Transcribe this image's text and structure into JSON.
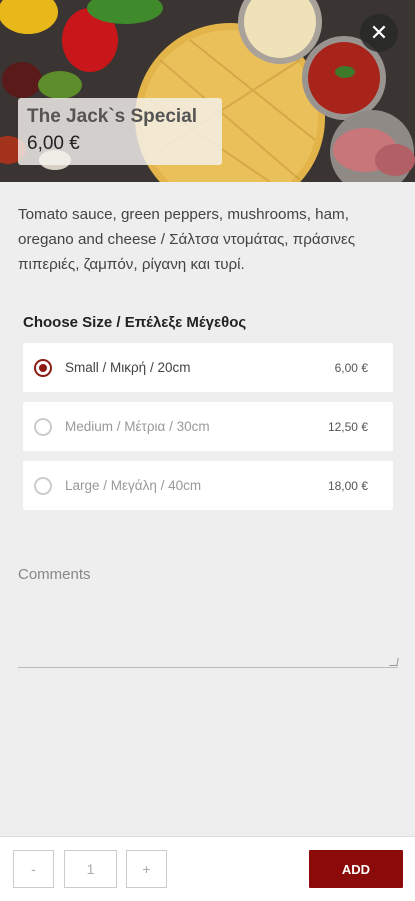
{
  "product": {
    "name": "The Jack`s Special",
    "price": "6,00 €",
    "description": "Tomato sauce, green peppers, mushrooms, ham, oregano and cheese / Σάλτσα ντομάτας, πράσινες πιπεριές, ζαμπόν, ρίγανη και τυρί."
  },
  "size_section": {
    "heading": "Choose Size / Επέλεξε Μέγεθος",
    "options": [
      {
        "label": "Small / Μικρή / 20cm",
        "price": "6,00 €",
        "selected": true
      },
      {
        "label": "Medium / Μέτρια / 30cm",
        "price": "12,50 €",
        "selected": false
      },
      {
        "label": "Large / Μεγάλη / 40cm",
        "price": "18,00 €",
        "selected": false
      }
    ]
  },
  "comments": {
    "placeholder": "Comments"
  },
  "footer": {
    "minus_label": "-",
    "quantity": "1",
    "plus_label": "+",
    "add_label": "ADD"
  },
  "icons": {
    "close": "close-icon"
  },
  "colors": {
    "accent": "#8b0a0a",
    "background": "#eeeeee"
  }
}
